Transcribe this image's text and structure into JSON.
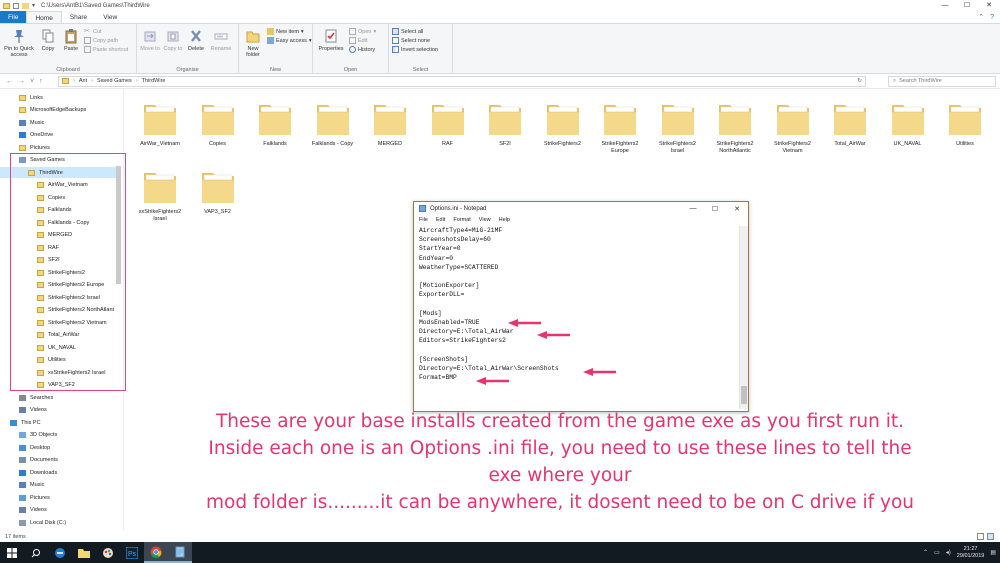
{
  "window": {
    "title": "C:\\Users\\AntB1\\Saved Games\\ThirdWire",
    "controls": {
      "minimize": "—",
      "maximize": "☐",
      "close": "✕"
    }
  },
  "ribbon": {
    "tabs": [
      "File",
      "Home",
      "Share",
      "View"
    ],
    "active_tab": "Home",
    "groups": {
      "clipboard": {
        "label": "Clipboard",
        "pin": "Pin to Quick access",
        "copy": "Copy",
        "paste": "Paste",
        "cut": "Cut",
        "copy_path": "Copy path",
        "paste_shortcut": "Paste shortcut"
      },
      "organise": {
        "label": "Organise",
        "move_to": "Move to",
        "copy_to": "Copy to",
        "delete": "Delete",
        "rename": "Rename"
      },
      "new": {
        "label": "New",
        "new_folder": "New folder",
        "new_item": "New item",
        "easy_access": "Easy access"
      },
      "open": {
        "label": "Open",
        "properties": "Properties",
        "open": "Open",
        "edit": "Edit",
        "history": "History"
      },
      "select": {
        "label": "Select",
        "select_all": "Select all",
        "select_none": "Select none",
        "invert": "Invert selection"
      }
    }
  },
  "address": {
    "crumbs": [
      "Ant",
      "Saved Games",
      "ThirdWire"
    ],
    "search_placeholder": "Search ThirdWire"
  },
  "nav_pane": {
    "items": [
      {
        "label": "Links",
        "icon": "folder",
        "indent": 1
      },
      {
        "label": "MicrosoftEdgeBackups",
        "icon": "folder",
        "indent": 1
      },
      {
        "label": "Music",
        "icon": "music",
        "indent": 1
      },
      {
        "label": "OneDrive",
        "icon": "cloud",
        "indent": 1
      },
      {
        "label": "Pictures",
        "icon": "folder",
        "indent": 1
      },
      {
        "label": "Saved Games",
        "icon": "savedgames",
        "indent": 1
      },
      {
        "label": "ThirdWire",
        "icon": "folder",
        "indent": 2,
        "selected": true
      },
      {
        "label": "AirWar_Vietnam",
        "icon": "folder",
        "indent": 3
      },
      {
        "label": "Copies",
        "icon": "folder",
        "indent": 3
      },
      {
        "label": "Falklands",
        "icon": "folder",
        "indent": 3
      },
      {
        "label": "Falklands - Copy",
        "icon": "folder",
        "indent": 3
      },
      {
        "label": "MERGED",
        "icon": "folder",
        "indent": 3
      },
      {
        "label": "RAF",
        "icon": "folder",
        "indent": 3
      },
      {
        "label": "SF2I",
        "icon": "folder",
        "indent": 3
      },
      {
        "label": "StrikeFighters2",
        "icon": "folder",
        "indent": 3
      },
      {
        "label": "StrikeFighters2 Europe",
        "icon": "folder",
        "indent": 3
      },
      {
        "label": "StrikeFighters2 Israel",
        "icon": "folder",
        "indent": 3
      },
      {
        "label": "StrikeFighters2 NorthAtlant",
        "icon": "folder",
        "indent": 3
      },
      {
        "label": "StrikeFighters2 Vietnam",
        "icon": "folder",
        "indent": 3
      },
      {
        "label": "Total_AirWar",
        "icon": "folder",
        "indent": 3
      },
      {
        "label": "UK_NAVAL",
        "icon": "folder",
        "indent": 3
      },
      {
        "label": "Utilities",
        "icon": "folder",
        "indent": 3
      },
      {
        "label": "xxStrikeFighters2 Israel",
        "icon": "folder",
        "indent": 3
      },
      {
        "label": "VAP3_SF2",
        "icon": "folder",
        "indent": 3
      },
      {
        "label": "Searches",
        "icon": "search",
        "indent": 1
      },
      {
        "label": "Videos",
        "icon": "video",
        "indent": 1
      },
      {
        "label": "This PC",
        "icon": "pc",
        "indent": 0
      },
      {
        "label": "3D Objects",
        "icon": "cube",
        "indent": 1
      },
      {
        "label": "Desktop",
        "icon": "desktop",
        "indent": 1
      },
      {
        "label": "Documents",
        "icon": "doc",
        "indent": 1
      },
      {
        "label": "Downloads",
        "icon": "download",
        "indent": 1
      },
      {
        "label": "Music",
        "icon": "music",
        "indent": 1
      },
      {
        "label": "Pictures",
        "icon": "picture",
        "indent": 1
      },
      {
        "label": "Videos",
        "icon": "video",
        "indent": 1
      },
      {
        "label": "Local Disk (C:)",
        "icon": "drive",
        "indent": 1
      }
    ]
  },
  "folders": [
    [
      "AirWar_Vietnam"
    ],
    [
      "Copies"
    ],
    [
      "Falklands"
    ],
    [
      "Falklands - Copy"
    ],
    [
      "MERGED"
    ],
    [
      "RAF"
    ],
    [
      "SF2I"
    ],
    [
      "StrikeFighters2"
    ],
    [
      "StrikeFighters2",
      "Europe"
    ],
    [
      "StrikeFighters2",
      "Israel"
    ],
    [
      "StrikeFighters2",
      "NorthAtlantic"
    ],
    [
      "StrikeFighters2",
      "Vietnam"
    ],
    [
      "Total_AirWar"
    ],
    [
      "UK_NAVAL"
    ],
    [
      "Utilities"
    ],
    [
      "xxStrikeFighters2",
      "Israel"
    ],
    [
      "VAP3_SF2"
    ]
  ],
  "notepad": {
    "title": "Options.ini - Notepad",
    "menu": [
      "File",
      "Edit",
      "Format",
      "View",
      "Help"
    ],
    "lines": [
      "AircraftType4=MiG-21MF",
      "ScreenshotsDelay=60",
      "StartYear=0",
      "EndYear=0",
      "WeatherType=SCATTERED",
      "",
      "[MotionExporter]",
      "ExporterDLL=",
      "",
      "[Mods]",
      "ModsEnabled=TRUE",
      "Directory=E:\\Total_AirWar",
      "Editors=StrikeFighters2",
      "",
      "[ScreenShots]",
      "Directory=E:\\Total_AirWar\\ScreenShots",
      "Format=BMP"
    ]
  },
  "status": {
    "item_count": "17 items"
  },
  "caption": {
    "lines": [
      "These are your base installs created from the game exe as you first run it.",
      "Inside each one is an Options .ini file, you need to use these lines to tell the",
      "exe where your",
      "mod folder is.........it can be anywhere, it dosent need to be on C drive if you"
    ]
  },
  "taskbar": {
    "apps": [
      "windows-start-icon",
      "search-icon",
      "edge-icon",
      "file-explorer-icon",
      "paint-icon",
      "photoshop-icon",
      "chrome-icon",
      "notepad-icon"
    ],
    "time": "21:27",
    "date": "29/01/2019"
  },
  "colors": {
    "accent": "#1979ca",
    "annotation": "#e8336e",
    "folder": "#f3d57a"
  }
}
